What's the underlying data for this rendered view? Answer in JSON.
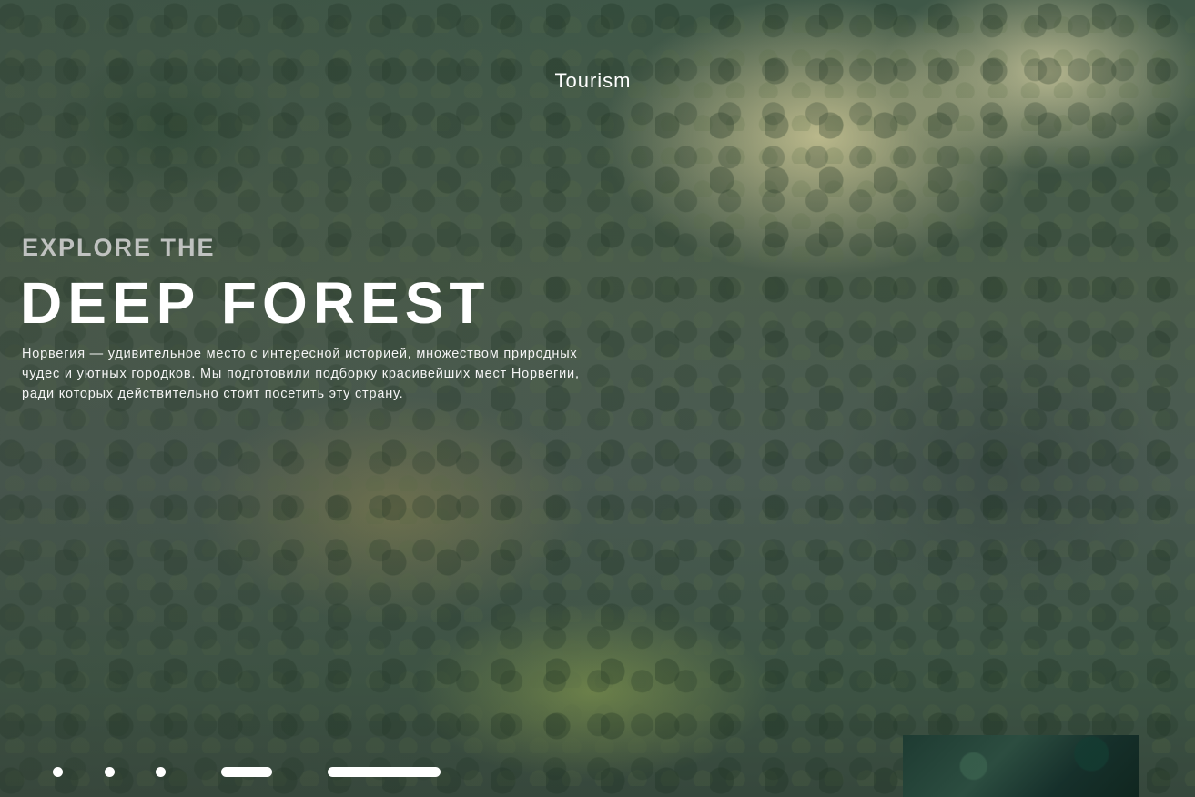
{
  "header": {
    "brand": "Tourism"
  },
  "hero": {
    "kicker": "EXPLORE THE",
    "title": "DEEP FOREST",
    "description": "Норвегия — удивительное место с интересной историей, множеством природных чудес и уютных городков. Мы подготовили подборку красивейших мест Норвегии, ради которых действительно стоит посетить эту страну."
  },
  "slider": {
    "indicators": [
      "dot",
      "dot",
      "dot",
      "bar",
      "bar"
    ],
    "thumbnail": "forest-thumbnail"
  },
  "colors": {
    "text": "#ffffff",
    "kicker": "#d2d2d2",
    "forest_dark": "#3f5848",
    "mist": "#cec896"
  }
}
